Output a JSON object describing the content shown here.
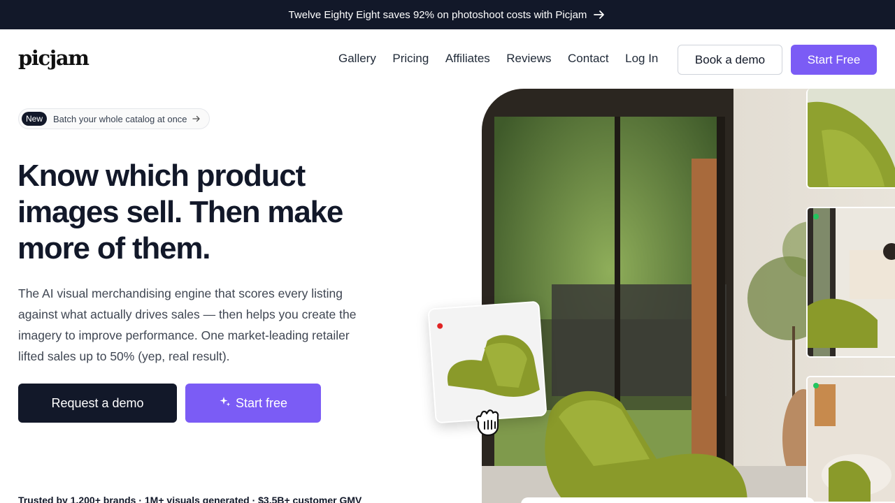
{
  "announcement": {
    "text": "Twelve Eighty Eight saves 92% on photoshoot costs with Picjam",
    "icon": "arrow-right-icon"
  },
  "nav": {
    "logo": "picjam",
    "links": [
      "Gallery",
      "Pricing",
      "Affiliates",
      "Reviews",
      "Contact",
      "Log In"
    ],
    "book_demo": "Book a demo",
    "start_free": "Start Free"
  },
  "badge": {
    "pill": "New",
    "text": "Batch your whole catalog at once",
    "icon": "arrow-right-icon"
  },
  "hero": {
    "headline": "Know which product images sell. Then make more of them.",
    "subtext": "The AI visual merchandising engine that scores every listing against what actually drives sales — then helps you create the imagery to improve performance. One market-leading retailer lifted sales up to 50% (yep, real result).",
    "cta_primary": "Request a demo",
    "cta_secondary": "Start free",
    "cta_secondary_icon": "sparkle-icon",
    "trusted": "Trusted by 1,200+ brands · 1M+ visuals generated · $3.5B+ customer GMV"
  },
  "colors": {
    "dark": "#121829",
    "accent": "#7b5cf5",
    "chair": "#8a9a2a",
    "status_red": "#e02424",
    "status_green": "#22c55e"
  }
}
